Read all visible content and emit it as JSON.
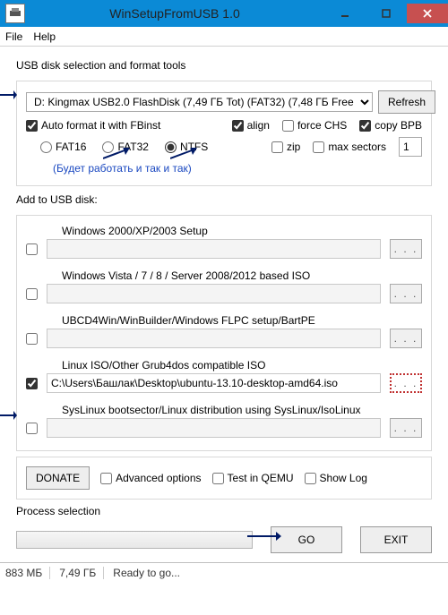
{
  "window": {
    "title": "WinSetupFromUSB 1.0"
  },
  "menu": {
    "file": "File",
    "help": "Help"
  },
  "usb": {
    "group": "USB disk selection and format tools",
    "disk": "D: Kingmax USB2.0 FlashDisk (7,49 ГБ Tot) (FAT32) (7,48 ГБ Free",
    "refresh": "Refresh",
    "autoformat": "Auto format it with FBinst",
    "fat16": "FAT16",
    "fat32": "FAT32",
    "ntfs": "NTFS",
    "align": "align",
    "forcechs": "force CHS",
    "copybpb": "copy BPB",
    "zip": "zip",
    "maxsectors": "max sectors",
    "maxsectors_val": "1",
    "note": "(Будет работать и так и так)"
  },
  "add": {
    "group": "Add to USB disk:",
    "win2000": "Windows 2000/XP/2003 Setup",
    "winvista": "Windows Vista / 7 / 8 / Server 2008/2012 based ISO",
    "ubcd": "UBCD4Win/WinBuilder/Windows FLPC setup/BartPE",
    "linux": "Linux ISO/Other Grub4dos compatible ISO",
    "linux_path": "C:\\Users\\Башлак\\Desktop\\ubuntu-13.10-desktop-amd64.iso",
    "syslinux": "SysLinux bootsector/Linux distribution using SysLinux/IsoLinux",
    "browse": ". . ."
  },
  "footer": {
    "donate": "DONATE",
    "advanced": "Advanced options",
    "test": "Test in QEMU",
    "showlog": "Show Log",
    "process": "Process selection",
    "go": "GO",
    "exit": "EXIT"
  },
  "status": {
    "s1": "883 МБ",
    "s2": "7,49 ГБ",
    "s3": "Ready to go..."
  }
}
